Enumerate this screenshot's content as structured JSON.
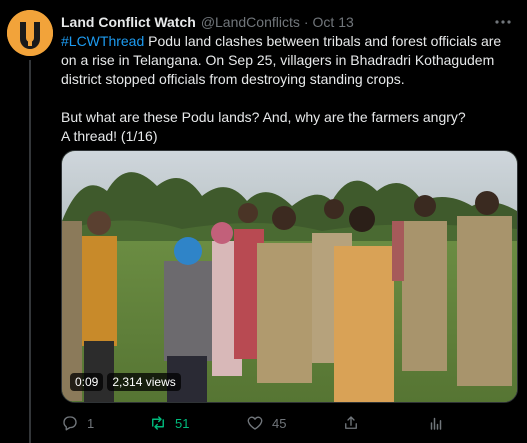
{
  "author": {
    "name": "Land Conflict Watch",
    "handle": "@LandConflicts",
    "separator": "·",
    "date": "Oct 13"
  },
  "tweet": {
    "hashtag": "#LCWThread",
    "line1_rest": " Podu land clashes between tribals and forest officials are on a rise in Telangana. On Sep 25, villagers in Bhadradri Kothagudem district stopped officials from destroying standing crops.",
    "line2": "But what are these Podu lands? And, why are the farmers angry?",
    "line3": "A thread! (1/16)"
  },
  "media": {
    "duration": "0:09",
    "views": "2,314 views"
  },
  "actions": {
    "replies": "1",
    "retweets": "51",
    "likes": "45"
  },
  "colors": {
    "background": "#000000",
    "text": "#e7e9ea",
    "muted": "#71767b",
    "link": "#1d9bf0",
    "retweet": "#00ba7c",
    "avatar": "#f2a33a"
  },
  "icons": [
    "avatar-logo",
    "more-icon",
    "reply-icon",
    "retweet-icon",
    "like-icon",
    "share-icon",
    "analytics-icon"
  ]
}
